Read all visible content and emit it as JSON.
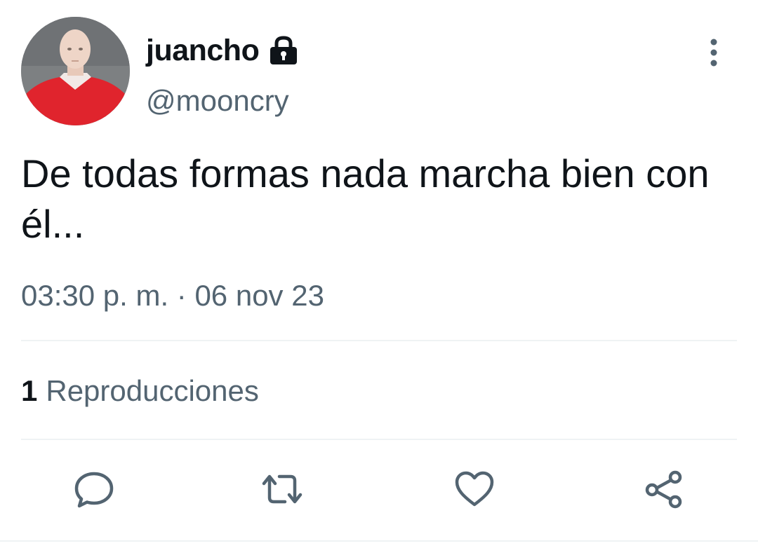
{
  "author": {
    "display_name": "juancho",
    "handle": "@mooncry",
    "protected_icon": "lock-icon"
  },
  "tweet": {
    "text": "De todas formas nada marcha bien con él...",
    "timestamp": "03:30 p. m. · 06 nov 23"
  },
  "stats": {
    "views_count": "1",
    "views_label": "Reproducciones"
  },
  "actions": {
    "reply_icon": "reply-icon",
    "retweet_icon": "retweet-icon",
    "like_icon": "heart-icon",
    "share_icon": "share-icon"
  },
  "colors": {
    "text_primary": "#0f1419",
    "text_secondary": "#536471",
    "divider": "#eff3f4"
  }
}
